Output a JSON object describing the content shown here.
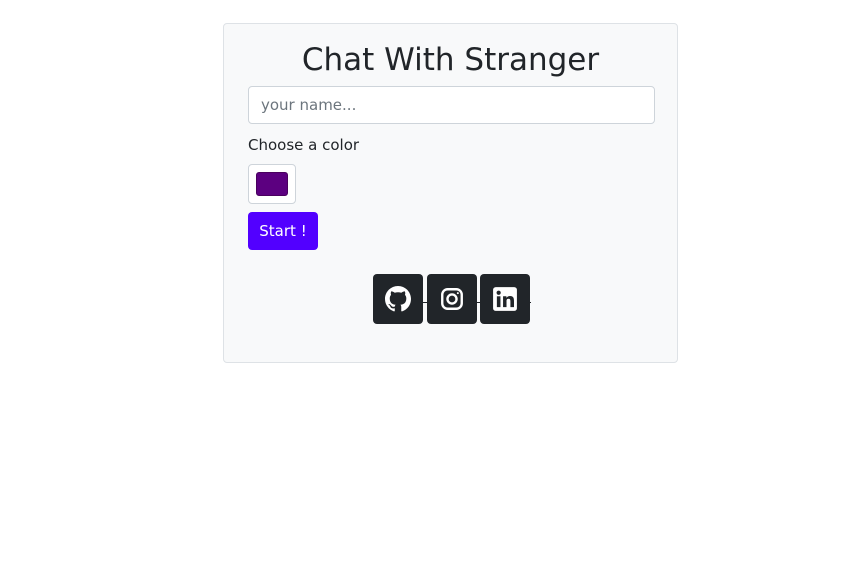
{
  "card": {
    "title": "Chat With Stranger",
    "name_input": {
      "value": "",
      "placeholder": "your name..."
    },
    "color_label": "Choose a color",
    "selected_color": "#5c0080",
    "start_label": "Start !"
  },
  "socials": [
    {
      "name": "github",
      "icon": "github-icon"
    },
    {
      "name": "instagram",
      "icon": "instagram-icon"
    },
    {
      "name": "linkedin",
      "icon": "linkedin-icon"
    }
  ],
  "colors": {
    "card_bg": "#f8f9fa",
    "button_primary": "#5200ff",
    "social_bg": "#212529"
  }
}
